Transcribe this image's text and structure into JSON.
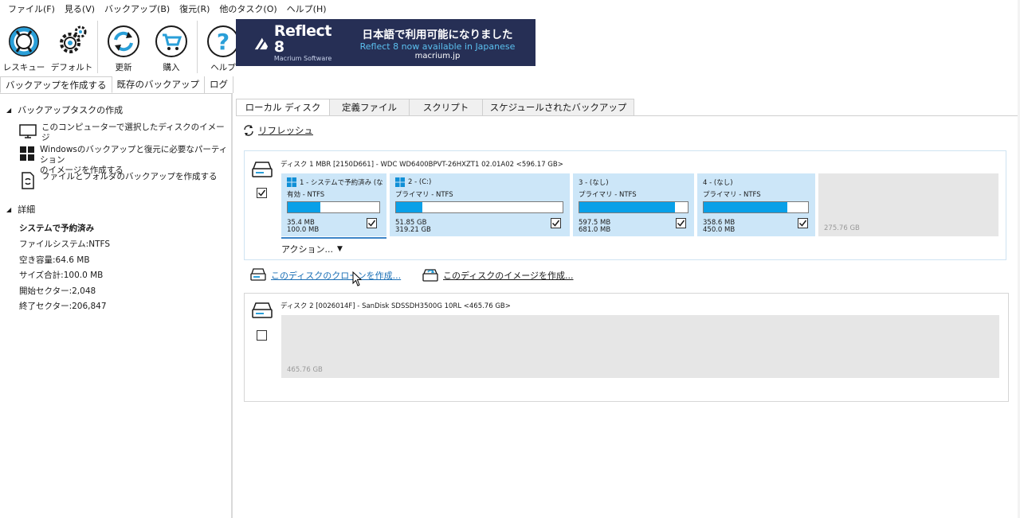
{
  "menu": [
    "ファイル(F)",
    "見る(V)",
    "バックアップ(B)",
    "復元(R)",
    "他のタスク(O)",
    "ヘルプ(H)"
  ],
  "toolbar": {
    "rescue": "レスキュー",
    "default": "デフォルト",
    "update": "更新",
    "buy": "購入",
    "help": "ヘルプ"
  },
  "banner": {
    "brand": "Reflect 8",
    "brand_sub": "Macrium Software",
    "jp": "日本語で利用可能になりました",
    "en": "Reflect 8 now available in Japanese",
    "url": "macrium.jp"
  },
  "left_tabs": [
    "バックアップを作成する",
    "既存のバックアップ",
    "ログ"
  ],
  "left_panel": {
    "tasks_header": "バックアップタスクの作成",
    "tasks": [
      "このコンピューターで選択したディスクのイメージ",
      "Windowsのバックアップと復元に必要なパーティション",
      "のイメージを作成する",
      "ファイルとフォルダのバックアップを作成する"
    ],
    "details_header": "詳細",
    "details": {
      "name": "システムで予約済み",
      "fs": "ファイルシステム:NTFS",
      "free": "空き容量:64.6 MB",
      "total": "サイズ合計:100.0 MB",
      "start": "開始セクター:2,048",
      "end": "終了セクター:206,847"
    }
  },
  "right_tabs": [
    "ローカル ディスク",
    "定義ファイル",
    "スクリプト",
    "スケジュールされたバックアップ"
  ],
  "refresh": "リフレッシュ",
  "disk1": {
    "header": "ディスク 1 MBR [2150D661] - WDC WD6400BPVT-26HXZT1 02.01A02  <596.17 GB>",
    "partitions": [
      {
        "title": "1 - システムで予約済み (な",
        "type": "有効 - NTFS",
        "used": "35.4 MB",
        "total": "100.0 MB",
        "fill": 0.36
      },
      {
        "title": "2 -  (C:)",
        "type": "プライマリ - NTFS",
        "used": "51.85 GB",
        "total": "319.21 GB",
        "fill": 0.16
      },
      {
        "title": "3 -  (なし)",
        "type": "プライマリ - NTFS",
        "used": "597.5 MB",
        "total": "681.0 MB",
        "fill": 0.88
      },
      {
        "title": "4 -  (なし)",
        "type": "プライマリ - NTFS",
        "used": "358.6 MB",
        "total": "450.0 MB",
        "fill": 0.8
      }
    ],
    "unallocated": "275.76 GB",
    "actions": "アクション..."
  },
  "links": {
    "clone": "このディスクのクローンを作成...",
    "image": "このディスクのイメージを作成..."
  },
  "disk2": {
    "header": "ディスク 2 [0026014F] - SanDisk  SDSSDH3500G      10RL  <465.76 GB>",
    "unallocated": "465.76 GB"
  },
  "colors": {
    "partition_bg": "#cce6f8",
    "bar_fill": "#09a0e8",
    "banner_bg": "#262f55",
    "link": "#1a6fb5"
  }
}
